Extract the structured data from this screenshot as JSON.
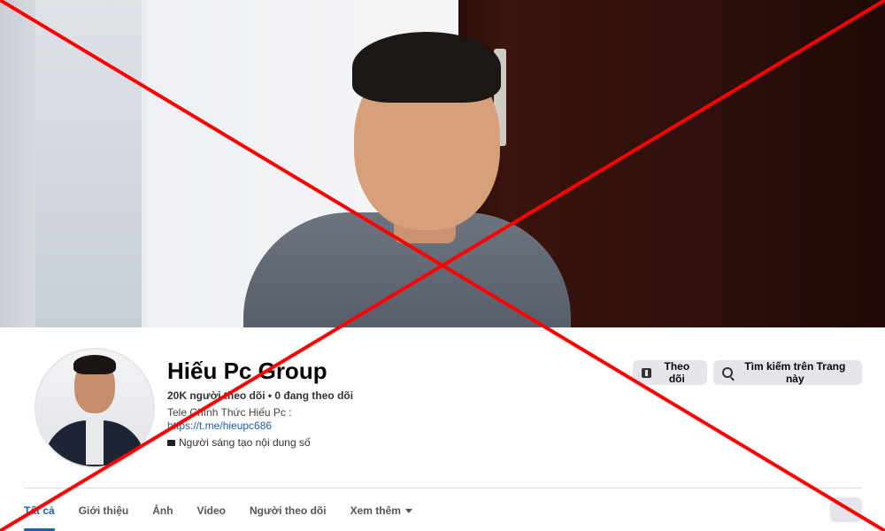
{
  "page": {
    "name": "Hiếu Pc Group",
    "stats": "20K người theo dõi • 0 đang theo dõi",
    "bio_line": "Tele Chính Thức Hiếu Pc :",
    "bio_link": "https://t.me/hieupc686",
    "category": "Người sáng tạo nội dung số"
  },
  "actions": {
    "follow_label": "Theo dõi",
    "search_label": "Tìm kiếm trên Trang này"
  },
  "tabs": [
    {
      "label": "Tất cả",
      "active": true
    },
    {
      "label": "Giới thiệu"
    },
    {
      "label": "Ảnh"
    },
    {
      "label": "Video"
    },
    {
      "label": "Người theo dõi"
    },
    {
      "label": "Xem thêm"
    }
  ],
  "colors": {
    "accent": "#1d5fb5",
    "overlay_x": "#ff0000"
  },
  "icons": [
    "follow-icon",
    "search-icon",
    "camera-icon",
    "chevron-down-icon",
    "more-icon"
  ]
}
